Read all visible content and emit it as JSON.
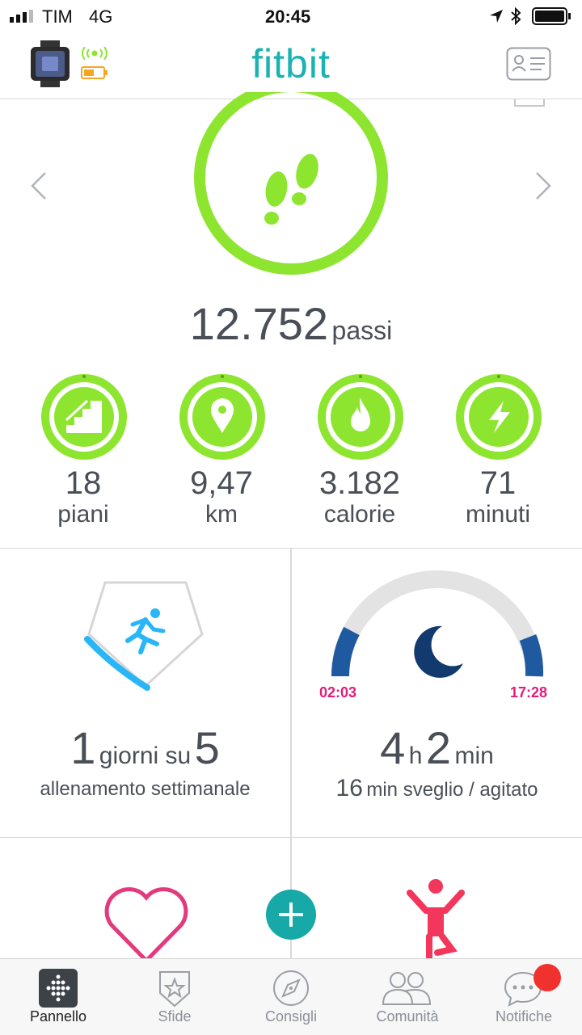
{
  "status_bar": {
    "carrier": "TIM",
    "network": "4G",
    "time": "20:45"
  },
  "header": {
    "logo": "fitbit"
  },
  "steps": {
    "value": "12.752",
    "unit": "passi"
  },
  "metrics": [
    {
      "icon": "stairs-icon",
      "value": "18",
      "unit": "piani"
    },
    {
      "icon": "location-pin-icon",
      "value": "9,47",
      "unit": "km"
    },
    {
      "icon": "flame-icon",
      "value": "3.182",
      "unit": "calorie"
    },
    {
      "icon": "lightning-icon",
      "value": "71",
      "unit": "minuti"
    }
  ],
  "exercise_card": {
    "count": "1",
    "middle": "giorni su",
    "goal": "5",
    "label": "allenamento settimanale"
  },
  "sleep_card": {
    "start": "02:03",
    "end": "17:28",
    "hours": "4",
    "h_unit": "h",
    "minutes": "2",
    "min_unit": "min",
    "awake_value": "16",
    "awake_text": "min sveglio / agitato"
  },
  "tabs": [
    {
      "label": "Pannello",
      "icon": "dashboard-icon",
      "active": true
    },
    {
      "label": "Sfide",
      "icon": "challenges-star-icon",
      "active": false
    },
    {
      "label": "Consigli",
      "icon": "compass-icon",
      "active": false
    },
    {
      "label": "Comunità",
      "icon": "community-icon",
      "active": false
    },
    {
      "label": "Notifiche",
      "icon": "chat-icon",
      "active": false
    }
  ],
  "colors": {
    "brand": "#1ab3b3",
    "activity_green": "#8ee530",
    "exercise_blue": "#29b6f6",
    "sleep_navy": "#133a6e",
    "heart_pink": "#e33a7d",
    "notification_red": "#f0312e"
  }
}
